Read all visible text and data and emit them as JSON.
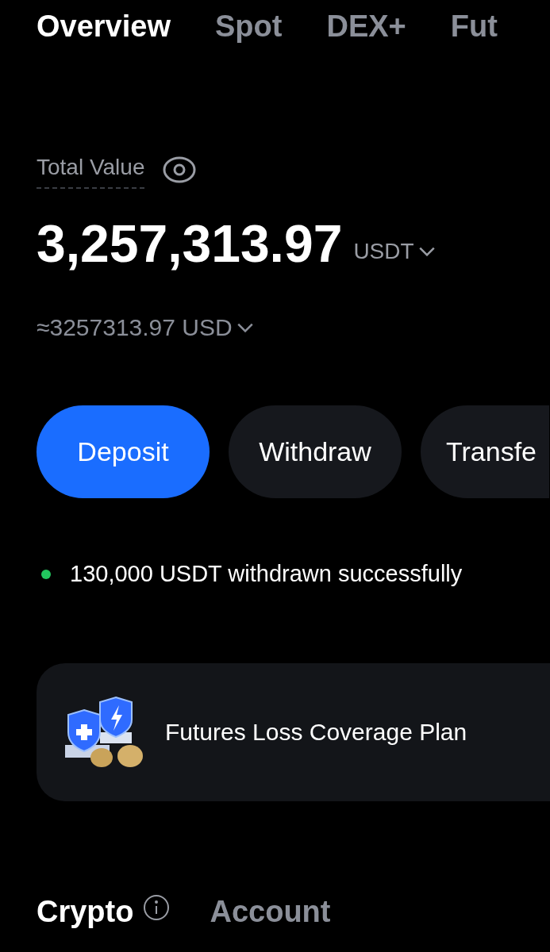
{
  "tabs": [
    {
      "label": "Overview",
      "selected": true
    },
    {
      "label": "Spot",
      "selected": false
    },
    {
      "label": "DEX+",
      "selected": false
    },
    {
      "label": "Fut",
      "selected": false
    }
  ],
  "total_value": {
    "label": "Total Value",
    "amount": "3,257,313.97",
    "currency": "USDT",
    "approx": "≈3257313.97 USD"
  },
  "actions": [
    {
      "label": "Deposit",
      "kind": "primary"
    },
    {
      "label": "Withdraw",
      "kind": "secondary"
    },
    {
      "label": "Transfe",
      "kind": "secondary"
    }
  ],
  "notice": {
    "text": "130,000 USDT withdrawn successfully",
    "color": "#22c55e"
  },
  "promo": {
    "title": "Futures Loss Coverage Plan"
  },
  "bottom_tabs": [
    {
      "label": "Crypto",
      "selected": true,
      "info": true
    },
    {
      "label": "Account",
      "selected": false,
      "info": false
    }
  ]
}
